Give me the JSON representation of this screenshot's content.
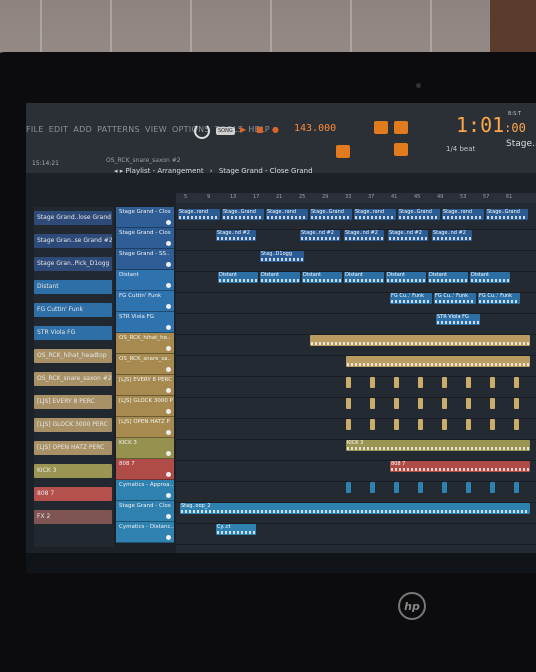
{
  "menu": [
    "FILE",
    "EDIT",
    "ADD",
    "PATTERNS",
    "VIEW",
    "OPTIONS",
    "TOOLS",
    "HELP"
  ],
  "toolbar": {
    "song_label": "SONG",
    "tempo": "143.000",
    "time": "1:01",
    "time_frac": ":00",
    "time_sub": "B:S:T",
    "snap": "1/4 beat",
    "pattern": "Stage..C",
    "time_small": "15:14:21",
    "current_pattern": "OS_RCK_snare_saxon #2",
    "accent": "#e27b1e"
  },
  "playlist": {
    "title": "Playlist - Arrangement",
    "breadcrumb": "Stage Grand - Close Grand"
  },
  "ruler": [
    "5",
    "9",
    "13",
    "17",
    "21",
    "25",
    "29",
    "33",
    "37",
    "41",
    "45",
    "49",
    "53",
    "57",
    "61"
  ],
  "channels": [
    {
      "label": "Stage Grand..lose Grand",
      "color": "#2e4a78"
    },
    {
      "label": "Stage Gran..se Grand #2",
      "color": "#2e4a78"
    },
    {
      "label": "Stage Gran..Pick_D1ogg",
      "color": "#2e4a78"
    },
    {
      "label": "Distant",
      "color": "#2e6fa8"
    },
    {
      "label": "FG Cuttin' Funk",
      "color": "#2e6fa8"
    },
    {
      "label": "STR Viola FG",
      "color": "#2e6fa8"
    },
    {
      "label": "OS_RCK_hihat_headtop",
      "color": "#a89166"
    },
    {
      "label": "OS_RCK_snare_saxon #2",
      "color": "#a89166"
    },
    {
      "label": "[LJS] EVERY 8 PERC",
      "color": "#a89166"
    },
    {
      "label": "[LJS] GLOCK 3000 PERC",
      "color": "#a89166"
    },
    {
      "label": "[LJS] OPEN HATZ PERC",
      "color": "#a89166"
    },
    {
      "label": "KICK 3",
      "color": "#9a9553"
    },
    {
      "label": "808 7",
      "color": "#b4514d"
    },
    {
      "label": "FX 2",
      "color": "#7f5553"
    }
  ],
  "tracks": [
    {
      "label": "Stage Grand - Clos",
      "color": "#2f5e97"
    },
    {
      "label": "Stage Grand - Clos",
      "color": "#2f5e97"
    },
    {
      "label": "Stage Grand - SS..",
      "color": "#2f5e97"
    },
    {
      "label": "Distant",
      "color": "#2f73ae"
    },
    {
      "label": "FG Cuttin' Funk",
      "color": "#2f73ae"
    },
    {
      "label": "STR Viola FG",
      "color": "#2f73ae"
    },
    {
      "label": "OS_RCK_hihat_he..",
      "color": "#a78a4f"
    },
    {
      "label": "OS_RCK_snare_sa..",
      "color": "#a78a4f"
    },
    {
      "label": "[LJS] EVERY 8 PERC",
      "color": "#a78a4f"
    },
    {
      "label": "[LJS] GLOCK 3000 P",
      "color": "#a78a4f"
    },
    {
      "label": "[LJS] OPEN HATZ P",
      "color": "#a78a4f"
    },
    {
      "label": "KICK 3",
      "color": "#96914f"
    },
    {
      "label": "808 7",
      "color": "#b04c48"
    },
    {
      "label": "Cymatics - Approa..",
      "color": "#2f82b0"
    },
    {
      "label": "Stage Grand - Clos",
      "color": "#2f82b0"
    },
    {
      "label": "Cymatics - Distanc..",
      "color": "#2f82b0"
    }
  ],
  "clips": [
    {
      "lane": 0,
      "text": "Stage..rand",
      "color": "#2a5b92"
    },
    {
      "lane": 0,
      "text": "Stage..Grand",
      "color": "#2a5b92"
    },
    {
      "lane": 0,
      "text": "Stage..rand",
      "color": "#2a5b92"
    },
    {
      "lane": 0,
      "text": "Stage..Grand",
      "color": "#2a5b92"
    },
    {
      "lane": 0,
      "text": "Stage..rand",
      "color": "#2a5b92"
    },
    {
      "lane": 0,
      "text": "Stage..Grand",
      "color": "#2a5b92"
    },
    {
      "lane": 0,
      "text": "Stage..rand",
      "color": "#2a5b92"
    },
    {
      "lane": 0,
      "text": "Stage..Grand",
      "color": "#2a5b92"
    },
    {
      "lane": 1,
      "text": "Stage..nd #2",
      "color": "#2a5b92"
    },
    {
      "lane": 1,
      "text": "Stage..nd #2",
      "color": "#2a5b92"
    },
    {
      "lane": 1,
      "text": "Stage..nd #2",
      "color": "#2a5b92"
    },
    {
      "lane": 1,
      "text": "Stage..nd #2",
      "color": "#2a5b92"
    },
    {
      "lane": 1,
      "text": "Stage..nd #2",
      "color": "#2a5b92"
    },
    {
      "lane": 2,
      "text": "Stag..D1ogg",
      "color": "#2a5b92"
    },
    {
      "lane": 3,
      "text": "Distant",
      "color": "#2c6fa5"
    },
    {
      "lane": 3,
      "text": "Distant",
      "color": "#2c6fa5"
    },
    {
      "lane": 3,
      "text": "Distant",
      "color": "#2c6fa5"
    },
    {
      "lane": 3,
      "text": "Distant",
      "color": "#2c6fa5"
    },
    {
      "lane": 3,
      "text": "Distant",
      "color": "#2c6fa5"
    },
    {
      "lane": 3,
      "text": "Distant",
      "color": "#2c6fa5"
    },
    {
      "lane": 3,
      "text": "Distant",
      "color": "#2c6fa5"
    },
    {
      "lane": 4,
      "text": "FG Cu..' Funk",
      "color": "#2c6fa5"
    },
    {
      "lane": 4,
      "text": "FG Cu..' Funk",
      "color": "#2c6fa5"
    },
    {
      "lane": 4,
      "text": "FG Cu..' Funk",
      "color": "#2c6fa5"
    },
    {
      "lane": 5,
      "text": "STR Viola FG",
      "color": "#2c6fa5"
    },
    {
      "lane": 6,
      "text": "",
      "color": "#b89c62"
    },
    {
      "lane": 7,
      "text": "",
      "color": "#b89c62"
    },
    {
      "lane": 11,
      "text": "KICK 3",
      "color": "#9b9553"
    },
    {
      "lane": 12,
      "text": "808 7",
      "color": "#b04c48"
    },
    {
      "lane": 14,
      "text": "Stag..oop_2",
      "color": "#2f82b0"
    },
    {
      "lane": 15,
      "text": "Cy..ct",
      "color": "#2f82b0"
    }
  ]
}
